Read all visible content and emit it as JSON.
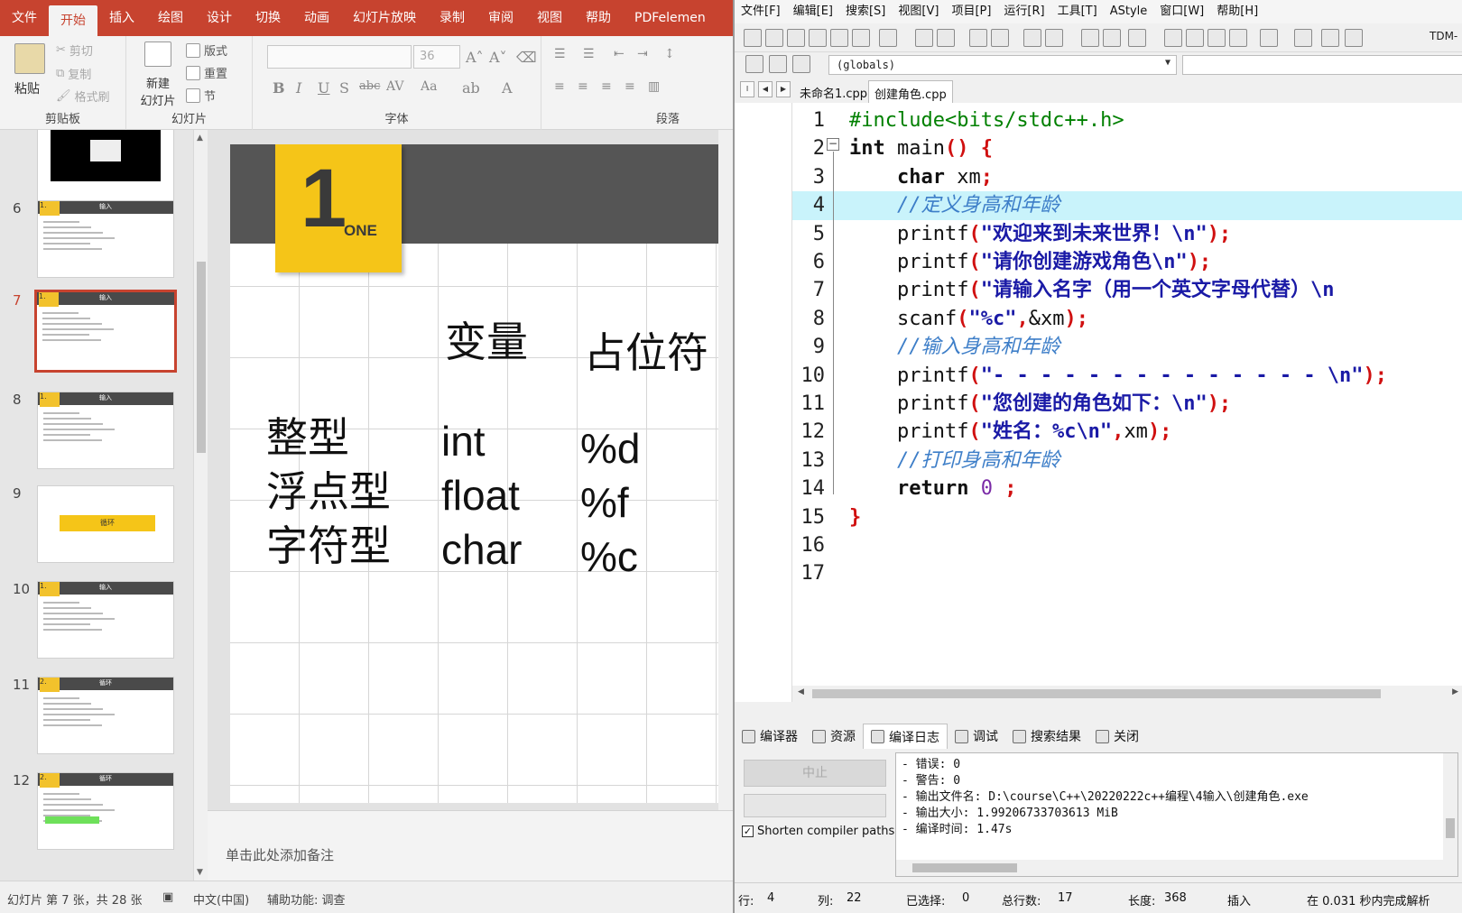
{
  "ppt": {
    "tabs": [
      "文件",
      "开始",
      "插入",
      "绘图",
      "设计",
      "切换",
      "动画",
      "幻灯片放映",
      "录制",
      "审阅",
      "视图",
      "帮助",
      "PDFelemen"
    ],
    "active_tab": "开始",
    "ribbon": {
      "paste": "粘贴",
      "cut": "剪切",
      "copy": "复制",
      "format_painter": "格式刷",
      "clipboard_group": "剪贴板",
      "new_slide_1": "新建",
      "new_slide_2": "幻灯片",
      "layout": "版式",
      "reset": "重置",
      "section": "节",
      "slides_group": "幻灯片",
      "font_size": "36",
      "font_group": "字体",
      "paragraph_group": "段落"
    },
    "thumbnails": [
      {
        "num": "6",
        "title": "输入",
        "badge": "1."
      },
      {
        "num": "7",
        "title": "输入",
        "badge": "1."
      },
      {
        "num": "8",
        "title": "输入",
        "badge": "1."
      },
      {
        "num": "9",
        "title": "循环",
        "badge": ""
      },
      {
        "num": "10",
        "title": "输入",
        "badge": "1."
      },
      {
        "num": "11",
        "title": "循环",
        "badge": "2."
      },
      {
        "num": "12",
        "title": "循环",
        "badge": "2."
      }
    ],
    "slide": {
      "badge_number": "1",
      "badge_word": "ONE",
      "header_var": "变量",
      "header_ph": "占位符",
      "rows": [
        {
          "type": "整型",
          "kw": "int",
          "ph": "%d"
        },
        {
          "type": "浮点型",
          "kw": "float",
          "ph": "%f"
        },
        {
          "type": "字符型",
          "kw": "char",
          "ph": "%c"
        }
      ]
    },
    "notes_placeholder": "单击此处添加备注",
    "status": {
      "slide_info": "幻灯片 第 7 张，共 28 张",
      "lang": "中文(中国)",
      "accessibility": "辅助功能: 调查"
    }
  },
  "ide": {
    "menu": [
      "文件[F]",
      "编辑[E]",
      "搜索[S]",
      "视图[V]",
      "项目[P]",
      "运行[R]",
      "工具[T]",
      "AStyle",
      "窗口[W]",
      "帮助[H]"
    ],
    "toolbar_extra": "TDM-",
    "globals": "(globals)",
    "file_tabs": [
      "未命名1.cpp",
      "创建角色.cpp"
    ],
    "active_file": "创建角色.cpp",
    "code_lines": [
      {
        "n": "1",
        "segs": [
          [
            "pp",
            "#include<bits/stdc++.h>"
          ]
        ]
      },
      {
        "n": "2",
        "segs": [
          [
            "kw",
            "int"
          ],
          [
            "",
            " main"
          ],
          [
            "sym",
            "()"
          ],
          [
            "",
            " "
          ],
          [
            "sym",
            "{"
          ]
        ]
      },
      {
        "n": "3",
        "segs": [
          [
            "",
            "    "
          ],
          [
            "kw",
            "char"
          ],
          [
            "",
            " xm"
          ],
          [
            "sym",
            ";"
          ]
        ]
      },
      {
        "n": "4",
        "segs": [
          [
            "",
            "    "
          ],
          [
            "cm",
            "//定义身高和年龄 "
          ]
        ]
      },
      {
        "n": "5",
        "segs": [
          [
            "",
            "    printf"
          ],
          [
            "sym",
            "("
          ],
          [
            "st",
            "\"欢迎来到未来世界！\\n\""
          ],
          [
            "sym",
            ");"
          ]
        ]
      },
      {
        "n": "6",
        "segs": [
          [
            "",
            "    printf"
          ],
          [
            "sym",
            "("
          ],
          [
            "st",
            "\"请你创建游戏角色\\n\""
          ],
          [
            "sym",
            ");"
          ]
        ]
      },
      {
        "n": "7",
        "segs": [
          [
            "",
            "    printf"
          ],
          [
            "sym",
            "("
          ],
          [
            "st",
            "\"请输入名字（用一个英文字母代替）\\n"
          ]
        ]
      },
      {
        "n": "8",
        "segs": [
          [
            "",
            "    scanf"
          ],
          [
            "sym",
            "("
          ],
          [
            "st",
            "\"%c\""
          ],
          [
            "sym",
            ","
          ],
          [
            "",
            "&xm"
          ],
          [
            "sym",
            ");"
          ]
        ]
      },
      {
        "n": "9",
        "segs": [
          [
            "",
            "    "
          ],
          [
            "cm",
            "//输入身高和年龄"
          ]
        ]
      },
      {
        "n": "10",
        "segs": [
          [
            "",
            "    printf"
          ],
          [
            "sym",
            "("
          ],
          [
            "st",
            "\"- - - - - - - - - - - - - - \\n\""
          ],
          [
            "sym",
            ");"
          ]
        ]
      },
      {
        "n": "11",
        "segs": [
          [
            "",
            "    printf"
          ],
          [
            "sym",
            "("
          ],
          [
            "st",
            "\"您创建的角色如下：\\n\""
          ],
          [
            "sym",
            ");"
          ]
        ]
      },
      {
        "n": "12",
        "segs": [
          [
            "",
            "    printf"
          ],
          [
            "sym",
            "("
          ],
          [
            "st",
            "\"姓名：%c\\n\""
          ],
          [
            "sym",
            ","
          ],
          [
            "",
            "xm"
          ],
          [
            "sym",
            ");"
          ]
        ]
      },
      {
        "n": "13",
        "segs": [
          [
            "",
            "    "
          ],
          [
            "cm",
            "//打印身高和年龄"
          ]
        ]
      },
      {
        "n": "14",
        "segs": [
          [
            "",
            "    "
          ],
          [
            "kw",
            "return"
          ],
          [
            "",
            " "
          ],
          [
            "nm",
            "0"
          ],
          [
            "",
            " "
          ],
          [
            "sym",
            ";"
          ]
        ]
      },
      {
        "n": "15",
        "segs": [
          [
            "sym",
            "}"
          ]
        ]
      },
      {
        "n": "16",
        "segs": []
      },
      {
        "n": "17",
        "segs": []
      }
    ],
    "current_line": "4",
    "bottom_tabs": [
      "编译器",
      "资源",
      "编译日志",
      "调试",
      "搜索结果",
      "关闭"
    ],
    "active_bottom_tab": "编译日志",
    "stop_button": "中止",
    "shorten_paths": "Shorten compiler paths",
    "log": [
      "- 错误: 0",
      "- 警告: 0",
      "- 输出文件名: D:\\course\\C++\\20220222c++编程\\4输入\\创建角色.exe",
      "- 输出大小: 1.99206733703613 MiB",
      "- 编译时间: 1.47s"
    ],
    "status": {
      "row_label": "行:",
      "row": "4",
      "col_label": "列:",
      "col": "22",
      "sel_label": "已选择:",
      "sel": "0",
      "lines_label": "总行数:",
      "lines": "17",
      "len_label": "长度:",
      "len": "368",
      "mode": "插入",
      "parse": "在 0.031 秒内完成解析"
    }
  }
}
